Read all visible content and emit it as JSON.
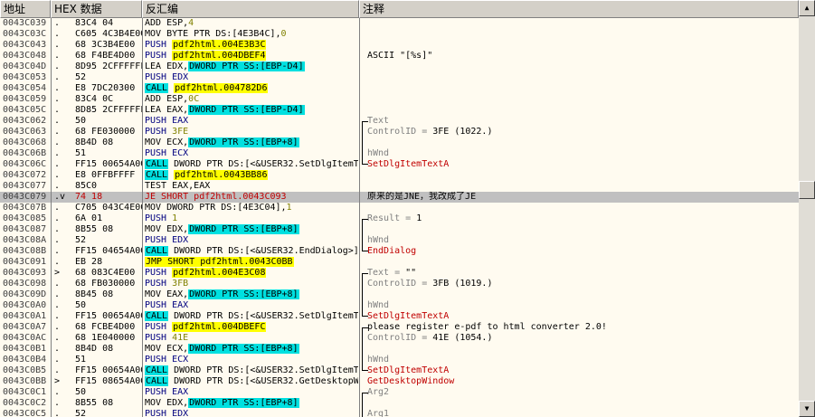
{
  "headers": {
    "address": "地址",
    "hex": "HEX 数据",
    "disasm": "反汇编",
    "comment": "注释"
  },
  "rows": [
    {
      "addr": "0043C039",
      "mark": ".",
      "hex": "83C4 04",
      "dis": [
        {
          "t": "ADD ESP,"
        },
        {
          "t": "4",
          "s": "num"
        }
      ],
      "cmt": []
    },
    {
      "addr": "0043C03C",
      "mark": ".",
      "hex": "C605 4C3B4E00",
      "dis": [
        {
          "t": "MOV BYTE PTR DS:[4E3B4C],"
        },
        {
          "t": "0",
          "s": "num"
        }
      ],
      "cmt": []
    },
    {
      "addr": "0043C043",
      "mark": ".",
      "hex": "68 3C3B4E00",
      "dis": [
        {
          "t": "PUSH ",
          "s": "blue"
        },
        {
          "t": "pdf2html.004E3B3C",
          "s": "y"
        }
      ],
      "cmt": []
    },
    {
      "addr": "0043C048",
      "mark": ".",
      "hex": "68 F4BE4D00",
      "dis": [
        {
          "t": "PUSH ",
          "s": "blue"
        },
        {
          "t": "pdf2html.004DBEF4",
          "s": "y"
        }
      ],
      "cmt": [
        {
          "t": "ASCII \"[%s]\""
        }
      ]
    },
    {
      "addr": "0043C04D",
      "mark": ".",
      "hex": "8D95 2CFFFFFF",
      "dis": [
        {
          "t": "LEA EDX,"
        },
        {
          "t": "DWORD PTR SS:[EBP-D4]",
          "s": "c"
        }
      ],
      "cmt": []
    },
    {
      "addr": "0043C053",
      "mark": ".",
      "hex": "52",
      "dis": [
        {
          "t": "PUSH EDX",
          "s": "blue"
        }
      ],
      "cmt": []
    },
    {
      "addr": "0043C054",
      "mark": ".",
      "hex": "E8 7DC20300",
      "dis": [
        {
          "t": "CALL",
          "s": "c"
        },
        {
          "t": " "
        },
        {
          "t": "pdf2html.004782D6",
          "s": "y"
        }
      ],
      "cmt": []
    },
    {
      "addr": "0043C059",
      "mark": ".",
      "hex": "83C4 0C",
      "dis": [
        {
          "t": "ADD ESP,"
        },
        {
          "t": "0C",
          "s": "num"
        }
      ],
      "cmt": []
    },
    {
      "addr": "0043C05C",
      "mark": ".",
      "hex": "8D85 2CFFFFFF",
      "dis": [
        {
          "t": "LEA EAX,"
        },
        {
          "t": "DWORD PTR SS:[EBP-D4]",
          "s": "c"
        }
      ],
      "cmt": []
    },
    {
      "addr": "0043C062",
      "mark": ".",
      "hex": "50",
      "dis": [
        {
          "t": "PUSH EAX",
          "s": "blue"
        }
      ],
      "cmt": [
        {
          "t": "Text",
          "s": "gray"
        }
      ],
      "brk": "top"
    },
    {
      "addr": "0043C063",
      "mark": ".",
      "hex": "68 FE030000",
      "dis": [
        {
          "t": "PUSH ",
          "s": "blue"
        },
        {
          "t": "3FE",
          "s": "num"
        }
      ],
      "cmt": [
        {
          "t": "ControlID = ",
          "s": "gray"
        },
        {
          "t": "3FE (1022.)"
        }
      ],
      "brk": "mid"
    },
    {
      "addr": "0043C068",
      "mark": ".",
      "hex": "8B4D 08",
      "dis": [
        {
          "t": "MOV ECX,"
        },
        {
          "t": "DWORD PTR SS:[EBP+8]",
          "s": "c"
        }
      ],
      "cmt": [],
      "brk": "mid"
    },
    {
      "addr": "0043C06B",
      "mark": ".",
      "hex": "51",
      "dis": [
        {
          "t": "PUSH ECX",
          "s": "blue"
        }
      ],
      "cmt": [
        {
          "t": "hWnd",
          "s": "gray"
        }
      ],
      "brk": "mid"
    },
    {
      "addr": "0043C06C",
      "mark": ".",
      "hex": "FF15 00654A00",
      "dis": [
        {
          "t": "CALL",
          "s": "c"
        },
        {
          "t": " DWORD PTR DS:[<&USER32.SetDlgItemTextA>]"
        }
      ],
      "cmt": [
        {
          "t": "SetDlgItemTextA",
          "s": "red"
        }
      ],
      "brk": "bot"
    },
    {
      "addr": "0043C072",
      "mark": ".",
      "hex": "E8 0FFBFFFF",
      "dis": [
        {
          "t": "CALL",
          "s": "c"
        },
        {
          "t": " "
        },
        {
          "t": "pdf2html.0043BB86",
          "s": "y"
        }
      ],
      "cmt": []
    },
    {
      "addr": "0043C077",
      "mark": ".",
      "hex": "85C0",
      "dis": [
        {
          "t": "TEST EAX,EAX"
        }
      ],
      "cmt": []
    },
    {
      "addr": "0043C079",
      "mark": ".v",
      "hex": "74 18",
      "dis": [
        {
          "t": "JE SHORT pdf2html.0043C093",
          "s": "red"
        }
      ],
      "cmt": [
        {
          "t": "原来的是JNE，我改成了JE"
        }
      ],
      "sel": true
    },
    {
      "addr": "0043C07B",
      "mark": ".",
      "hex": "C705 043C4E00",
      "dis": [
        {
          "t": "MOV DWORD PTR DS:[4E3C04],"
        },
        {
          "t": "1",
          "s": "num"
        }
      ],
      "cmt": []
    },
    {
      "addr": "0043C085",
      "mark": ".",
      "hex": "6A 01",
      "dis": [
        {
          "t": "PUSH ",
          "s": "blue"
        },
        {
          "t": "1",
          "s": "num"
        }
      ],
      "cmt": [
        {
          "t": "Result = ",
          "s": "gray"
        },
        {
          "t": "1"
        }
      ],
      "brk": "top"
    },
    {
      "addr": "0043C087",
      "mark": ".",
      "hex": "8B55 08",
      "dis": [
        {
          "t": "MOV EDX,"
        },
        {
          "t": "DWORD PTR SS:[EBP+8]",
          "s": "c"
        }
      ],
      "cmt": [],
      "brk": "mid"
    },
    {
      "addr": "0043C08A",
      "mark": ".",
      "hex": "52",
      "dis": [
        {
          "t": "PUSH EDX",
          "s": "blue"
        }
      ],
      "cmt": [
        {
          "t": "hWnd",
          "s": "gray"
        }
      ],
      "brk": "mid"
    },
    {
      "addr": "0043C08B",
      "mark": ".",
      "hex": "FF15 04654A00",
      "dis": [
        {
          "t": "CALL",
          "s": "c"
        },
        {
          "t": " DWORD PTR DS:[<&USER32.EndDialog>]"
        }
      ],
      "cmt": [
        {
          "t": "EndDialog",
          "s": "red"
        }
      ],
      "brk": "bot"
    },
    {
      "addr": "0043C091",
      "mark": ".",
      "hex": "EB 28",
      "dis": [
        {
          "t": "JMP SHORT pdf2html.0043C0BB",
          "s": "y"
        }
      ],
      "cmt": []
    },
    {
      "addr": "0043C093",
      "mark": ">",
      "hex": "68 083C4E00",
      "dis": [
        {
          "t": "PUSH ",
          "s": "blue"
        },
        {
          "t": "pdf2html.004E3C08",
          "s": "y"
        }
      ],
      "cmt": [
        {
          "t": "Text = ",
          "s": "gray"
        },
        {
          "t": "\"\""
        }
      ],
      "brk": "top"
    },
    {
      "addr": "0043C098",
      "mark": ".",
      "hex": "68 FB030000",
      "dis": [
        {
          "t": "PUSH ",
          "s": "blue"
        },
        {
          "t": "3FB",
          "s": "num"
        }
      ],
      "cmt": [
        {
          "t": "ControlID = ",
          "s": "gray"
        },
        {
          "t": "3FB (1019.)"
        }
      ],
      "brk": "mid"
    },
    {
      "addr": "0043C09D",
      "mark": ".",
      "hex": "8B45 08",
      "dis": [
        {
          "t": "MOV EAX,"
        },
        {
          "t": "DWORD PTR SS:[EBP+8]",
          "s": "c"
        }
      ],
      "cmt": [],
      "brk": "mid"
    },
    {
      "addr": "0043C0A0",
      "mark": ".",
      "hex": "50",
      "dis": [
        {
          "t": "PUSH EAX",
          "s": "blue"
        }
      ],
      "cmt": [
        {
          "t": "hWnd",
          "s": "gray"
        }
      ],
      "brk": "mid"
    },
    {
      "addr": "0043C0A1",
      "mark": ".",
      "hex": "FF15 00654A00",
      "dis": [
        {
          "t": "CALL",
          "s": "c"
        },
        {
          "t": " DWORD PTR DS:[<&USER32.SetDlgItemTextA>]"
        }
      ],
      "cmt": [
        {
          "t": "SetDlgItemTextA",
          "s": "red"
        }
      ],
      "brk": "bot"
    },
    {
      "addr": "0043C0A7",
      "mark": ".",
      "hex": "68 FCBE4D00",
      "dis": [
        {
          "t": "PUSH ",
          "s": "blue"
        },
        {
          "t": "pdf2html.004DBEFC",
          "s": "y"
        }
      ],
      "cmt": [
        {
          "t": "please register e-pdf to html converter 2.0!"
        }
      ],
      "brk": "top"
    },
    {
      "addr": "0043C0AC",
      "mark": ".",
      "hex": "68 1E040000",
      "dis": [
        {
          "t": "PUSH ",
          "s": "blue"
        },
        {
          "t": "41E",
          "s": "num"
        }
      ],
      "cmt": [
        {
          "t": "ControlID = ",
          "s": "gray"
        },
        {
          "t": "41E (1054.)"
        }
      ],
      "brk": "mid"
    },
    {
      "addr": "0043C0B1",
      "mark": ".",
      "hex": "8B4D 08",
      "dis": [
        {
          "t": "MOV ECX,"
        },
        {
          "t": "DWORD PTR SS:[EBP+8]",
          "s": "c"
        }
      ],
      "cmt": [],
      "brk": "mid"
    },
    {
      "addr": "0043C0B4",
      "mark": ".",
      "hex": "51",
      "dis": [
        {
          "t": "PUSH ECX",
          "s": "blue"
        }
      ],
      "cmt": [
        {
          "t": "hWnd",
          "s": "gray"
        }
      ],
      "brk": "mid"
    },
    {
      "addr": "0043C0B5",
      "mark": ".",
      "hex": "FF15 00654A00",
      "dis": [
        {
          "t": "CALL",
          "s": "c"
        },
        {
          "t": " DWORD PTR DS:[<&USER32.SetDlgItemTextA>]"
        }
      ],
      "cmt": [
        {
          "t": "SetDlgItemTextA",
          "s": "red"
        }
      ],
      "brk": "bot"
    },
    {
      "addr": "0043C0BB",
      "mark": ">",
      "hex": "FF15 08654A00",
      "dis": [
        {
          "t": "CALL",
          "s": "c"
        },
        {
          "t": " DWORD PTR DS:[<&USER32.GetDesktopWindow>]"
        }
      ],
      "cmt": [
        {
          "t": "GetDesktopWindow",
          "s": "red"
        }
      ]
    },
    {
      "addr": "0043C0C1",
      "mark": ".",
      "hex": "50",
      "dis": [
        {
          "t": "PUSH EAX",
          "s": "blue"
        }
      ],
      "cmt": [
        {
          "t": "Arg2",
          "s": "gray"
        }
      ],
      "brk": "top"
    },
    {
      "addr": "0043C0C2",
      "mark": ".",
      "hex": "8B55 08",
      "dis": [
        {
          "t": "MOV EDX,"
        },
        {
          "t": "DWORD PTR SS:[EBP+8]",
          "s": "c"
        }
      ],
      "cmt": [],
      "brk": "mid"
    },
    {
      "addr": "0043C0C5",
      "mark": ".",
      "hex": "52",
      "dis": [
        {
          "t": "PUSH EDX",
          "s": "blue"
        }
      ],
      "cmt": [
        {
          "t": "Arg1",
          "s": "gray"
        }
      ],
      "brk": "mid"
    }
  ],
  "colors": {
    "yellow": "#ffff00",
    "cyan": "#00e0e0",
    "red": "#c00000",
    "blue": "#000080",
    "num": "#808000"
  },
  "icons": {
    "scroll_up": "triangle-up-icon",
    "scroll_down": "triangle-down-icon"
  }
}
